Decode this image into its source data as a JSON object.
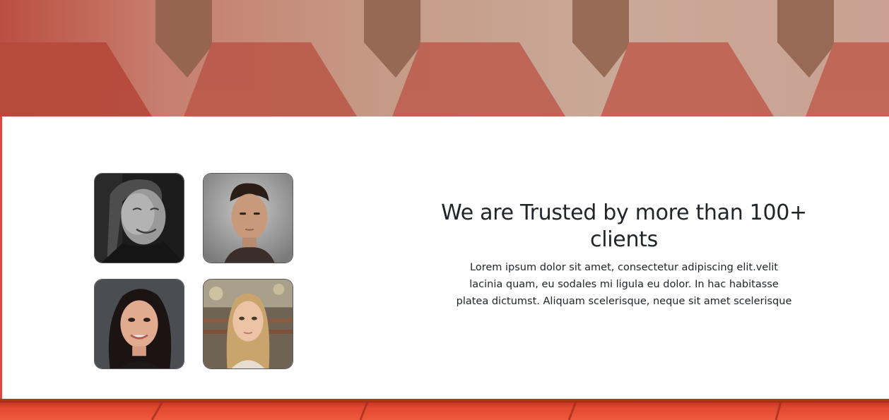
{
  "section": {
    "heading": "We are Trusted by more than 100+ clients",
    "description": "Lorem ipsum dolor sit amet, consectetur adipiscing elit.velit lacinia quam, eu sodales mi ligula eu dolor. In hac habitasse platea dictumst. Aliquam scelerisque, neque sit amet scelerisque"
  },
  "avatars": [
    {
      "icon": "client-photo-man-grayscale-icon"
    },
    {
      "icon": "client-photo-young-man-icon"
    },
    {
      "icon": "client-photo-woman-dark-hair-icon"
    },
    {
      "icon": "client-photo-woman-blonde-icon"
    }
  ],
  "colors": {
    "accent": "#d8432f",
    "card_background": "#ffffff",
    "text": "#212529"
  }
}
